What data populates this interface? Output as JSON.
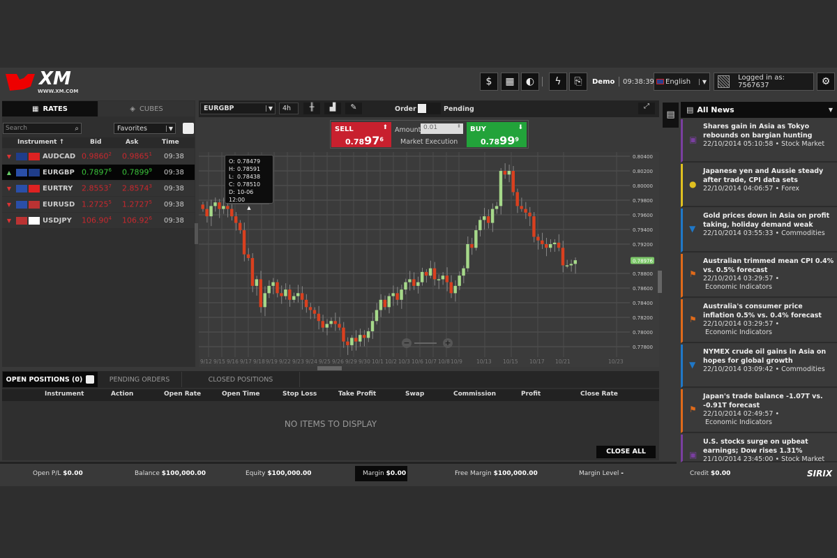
{
  "header": {
    "logo_text": "XM",
    "logo_url": "WWW.XM.COM",
    "mode": "Demo",
    "clock": "09:38:39",
    "language": "English",
    "logged_in": "Logged in as: 7567637"
  },
  "rates": {
    "tab_rates": "RATES",
    "tab_cubes": "CUBES",
    "search_placeholder": "Search",
    "list": "Favorites",
    "columns": [
      "Instrument ↑",
      "Bid",
      "Ask",
      "Time"
    ],
    "rows": [
      {
        "symbol": "AUDCAD",
        "dir": "down",
        "bid": "0.9860",
        "bid_sup": "2",
        "ask": "0.9865",
        "ask_sup": "1",
        "time": "09:38"
      },
      {
        "symbol": "EURGBP",
        "dir": "up",
        "bid": "0.7897",
        "bid_sup": "6",
        "ask": "0.7899",
        "ask_sup": "9",
        "time": "09:38"
      },
      {
        "symbol": "EURTRY",
        "dir": "down",
        "bid": "2.8553",
        "bid_sup": "7",
        "ask": "2.8574",
        "ask_sup": "3",
        "time": "09:38"
      },
      {
        "symbol": "EURUSD",
        "dir": "down",
        "bid": "1.2725",
        "bid_sup": "5",
        "ask": "1.2727",
        "ask_sup": "5",
        "time": "09:38"
      },
      {
        "symbol": "USDJPY",
        "dir": "down",
        "bid": "106.90",
        "bid_sup": "4",
        "ask": "106.92",
        "ask_sup": "6",
        "time": "09:38"
      }
    ]
  },
  "chart": {
    "symbol": "EURGBP",
    "timeframe": "4h",
    "order_label": "Order",
    "pending_label": "Pending",
    "sell": {
      "label": "SELL",
      "price_small": "0.78",
      "price_big": "97",
      "price_sup": "6"
    },
    "buy": {
      "label": "BUY",
      "price_small": "0.78",
      "price_big": "99",
      "price_sup": "9"
    },
    "amount_label": "Amount",
    "amount_value": "0.01",
    "execution": "Market Execution",
    "tooltip": {
      "o": "O:",
      "o_v": "0.78479",
      "h": "H:",
      "h_v": "0.78591",
      "l": "L:",
      "l_v": "0.78438",
      "c": "C:",
      "c_v": "0.78510",
      "d": "D:",
      "d_v": "10-06 12:00"
    }
  },
  "chart_data": {
    "type": "candlestick",
    "ylim": [
      0.777,
      0.805
    ],
    "y_ticks": [
      "0.80400",
      "0.80200",
      "0.80000",
      "0.79800",
      "0.79600",
      "0.79400",
      "0.79200",
      "0.78800",
      "0.78600",
      "0.78400",
      "0.78200",
      "0.78000",
      "0.77800"
    ],
    "current_price": "0.78976",
    "x_ticks": [
      "9/12",
      "9/15",
      "9/16",
      "9/17",
      "9/18",
      "9/19",
      "9/22",
      "9/23",
      "9/24",
      "9/25",
      "9/26",
      "9/29",
      "9/30",
      "10/1",
      "10/2",
      "10/3",
      "10/6",
      "10/7",
      "10/8",
      "10/9",
      "10/13",
      "10/15",
      "10/17",
      "10/21",
      "10/23"
    ],
    "closes": [
      0.7968,
      0.7958,
      0.7972,
      0.7977,
      0.7968,
      0.7972,
      0.7968,
      0.7958,
      0.7949,
      0.7939,
      0.7906,
      0.7901,
      0.7863,
      0.7872,
      0.7834,
      0.7853,
      0.7863,
      0.7868,
      0.7853,
      0.7849,
      0.7858,
      0.7844,
      0.7849,
      0.7853,
      0.7844,
      0.7834,
      0.783,
      0.7825,
      0.7815,
      0.7806,
      0.7811,
      0.7815,
      0.7811,
      0.7806,
      0.7787,
      0.7782,
      0.7792,
      0.7787,
      0.7796,
      0.7792,
      0.7801,
      0.7815,
      0.783,
      0.7844,
      0.7834,
      0.7849,
      0.7853,
      0.7844,
      0.7858,
      0.7868,
      0.7872,
      0.7863,
      0.7868,
      0.7882,
      0.7877,
      0.7887,
      0.7872,
      0.7872,
      0.7877,
      0.7868,
      0.7853,
      0.7863,
      0.7877,
      0.7887,
      0.792,
      0.7915,
      0.7939,
      0.7953,
      0.7958,
      0.7949,
      0.7968,
      0.7972,
      0.802,
      0.8015,
      0.802,
      0.7991,
      0.7972,
      0.7968,
      0.7963,
      0.7958,
      0.793,
      0.7925,
      0.792,
      0.7915,
      0.792,
      0.7922,
      0.7915,
      0.7891,
      0.7891,
      0.7893,
      0.7898
    ],
    "up_color": "#a6d98a",
    "down_color": "#d9401f"
  },
  "positions": {
    "tabs": [
      "OPEN POSITIONS (0)",
      "PENDING ORDERS",
      "CLOSED POSITIONS"
    ],
    "columns": [
      "Instrument",
      "Action",
      "Open Rate",
      "Open Time",
      "Stop Loss",
      "Take Profit",
      "Swap",
      "Commission",
      "Profit",
      "Close Rate"
    ],
    "empty": "NO ITEMS TO DISPLAY",
    "close_all": "CLOSE ALL"
  },
  "footer": [
    {
      "label": "Open P/L",
      "value": "$0.00"
    },
    {
      "label": "Balance",
      "value": "$100,000.00"
    },
    {
      "label": "Equity",
      "value": "$100,000.00"
    },
    {
      "label": "Margin",
      "value": "$0.00"
    },
    {
      "label": "Free Margin",
      "value": "$100,000.00"
    },
    {
      "label": "Margin Level",
      "value": "-"
    },
    {
      "label": "Credit",
      "value": "$0.00"
    }
  ],
  "brand": "SIRIX",
  "news": {
    "title": "All News",
    "items": [
      {
        "title": "Shares gain in Asia as Tokyo rebounds on bargian hunting",
        "meta": "22/10/2014 05:10:58 • Stock Market",
        "color": "#7a3fa0",
        "icon": "chart-icon"
      },
      {
        "title": "Japanese yen and Aussie steady after trade, CPI data sets",
        "meta": "22/10/2014 04:06:57 • Forex",
        "color": "#e0c020",
        "icon": "coins-icon"
      },
      {
        "title": "Gold prices down in Asia on profit taking, holiday demand weak",
        "meta": "22/10/2014 03:55:33 • Commodities",
        "color": "#1f78c8",
        "icon": "bucket-icon"
      },
      {
        "title": "Australian trimmed mean CPI 0.4% vs. 0.5% forecast",
        "meta": "22/10/2014 03:29:57 •",
        "meta2": "Economic Indicators",
        "color": "#e06a1a",
        "icon": "flag-icon"
      },
      {
        "title": "Australia's consumer price inflation 0.5% vs. 0.4% forecast",
        "meta": "22/10/2014 03:29:57 •",
        "meta2": "Economic Indicators",
        "color": "#e06a1a",
        "icon": "flag-icon"
      },
      {
        "title": "NYMEX crude oil gains in Asia on hopes for global growth",
        "meta": "22/10/2014 03:09:42 • Commodities",
        "color": "#1f78c8",
        "icon": "bucket-icon"
      },
      {
        "title": "Japan's trade balance -1.07T vs. -0.91T forecast",
        "meta": "22/10/2014 02:49:57 •",
        "meta2": "Economic Indicators",
        "color": "#e06a1a",
        "icon": "flag-icon"
      },
      {
        "title": "U.S. stocks surge on upbeat earnings; Dow rises 1.31%",
        "meta": "21/10/2014 23:45:00 • Stock Market",
        "color": "#7a3fa0",
        "icon": "chart-icon"
      }
    ]
  }
}
